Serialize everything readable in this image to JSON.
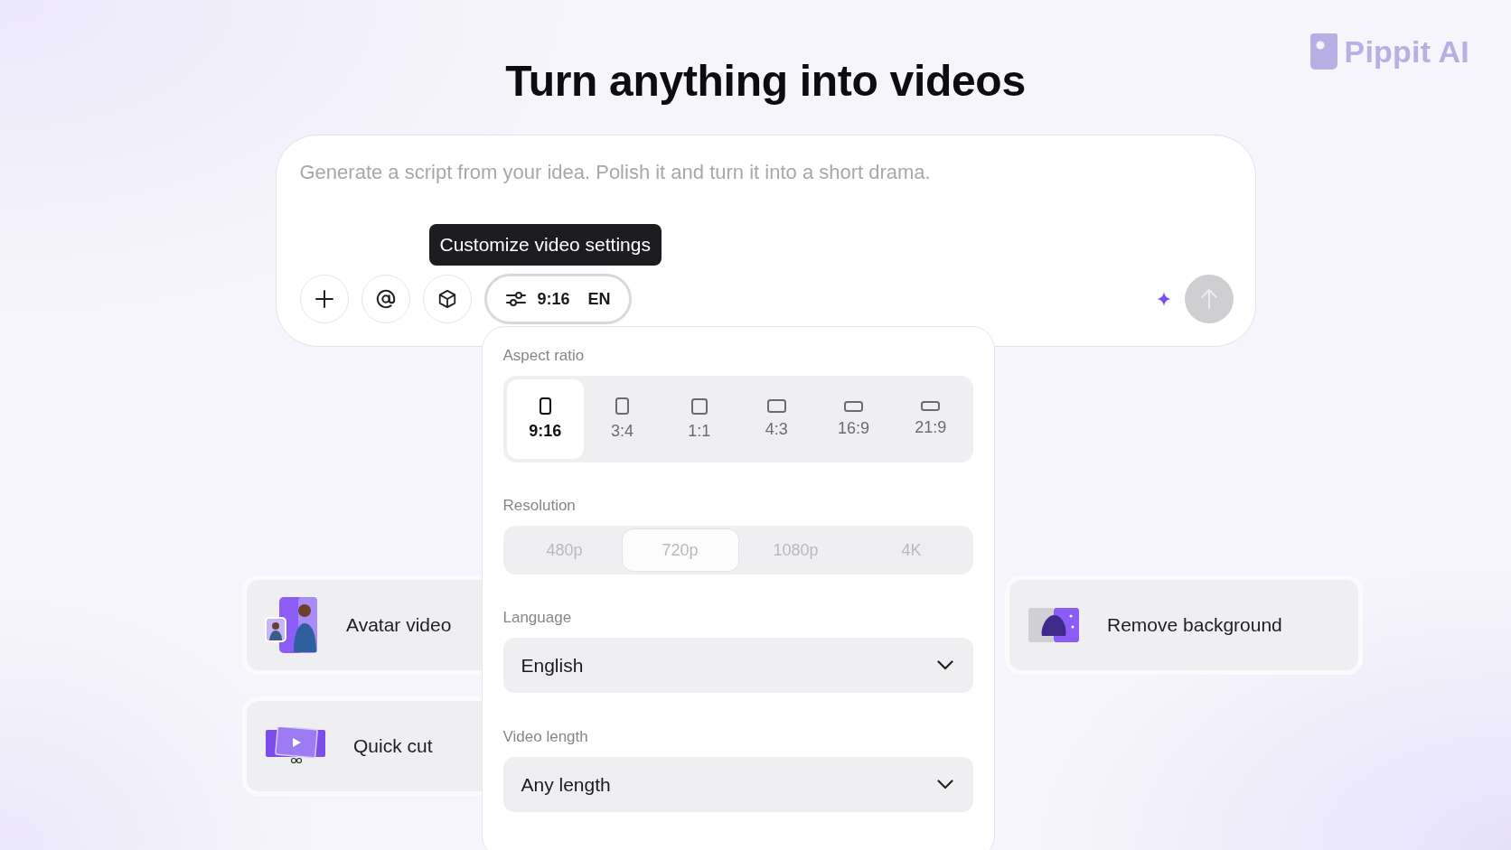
{
  "title": "Turn anything into videos",
  "logo": {
    "text": "Pippit AI"
  },
  "prompt": {
    "placeholder": "Generate a script from your idea. Polish it and turn it into a short drama.",
    "tooltip": "Customize video settings",
    "settings_button": {
      "ratio": "9:16",
      "language": "EN"
    },
    "send_button": {
      "disabled": true
    }
  },
  "settings_panel": {
    "aspect_ratio": {
      "label": "Aspect ratio",
      "options": [
        {
          "label": "9:16",
          "selected": true
        },
        {
          "label": "3:4",
          "selected": false
        },
        {
          "label": "1:1",
          "selected": false
        },
        {
          "label": "4:3",
          "selected": false
        },
        {
          "label": "16:9",
          "selected": false
        },
        {
          "label": "21:9",
          "selected": false
        }
      ]
    },
    "resolution": {
      "label": "Resolution",
      "disabled": true,
      "options": [
        {
          "label": "480p",
          "selected": false
        },
        {
          "label": "720p",
          "selected": true
        },
        {
          "label": "1080p",
          "selected": false
        },
        {
          "label": "4K",
          "selected": false
        }
      ]
    },
    "language": {
      "label": "Language",
      "value": "English"
    },
    "video_length": {
      "label": "Video length",
      "value": "Any length"
    }
  },
  "cards_left": [
    {
      "label": "Avatar video",
      "kind": "avatar"
    },
    {
      "label": "Quick cut",
      "kind": "cut"
    }
  ],
  "cards_right": [
    {
      "label": "Remove background",
      "kind": "remove_bg"
    }
  ]
}
